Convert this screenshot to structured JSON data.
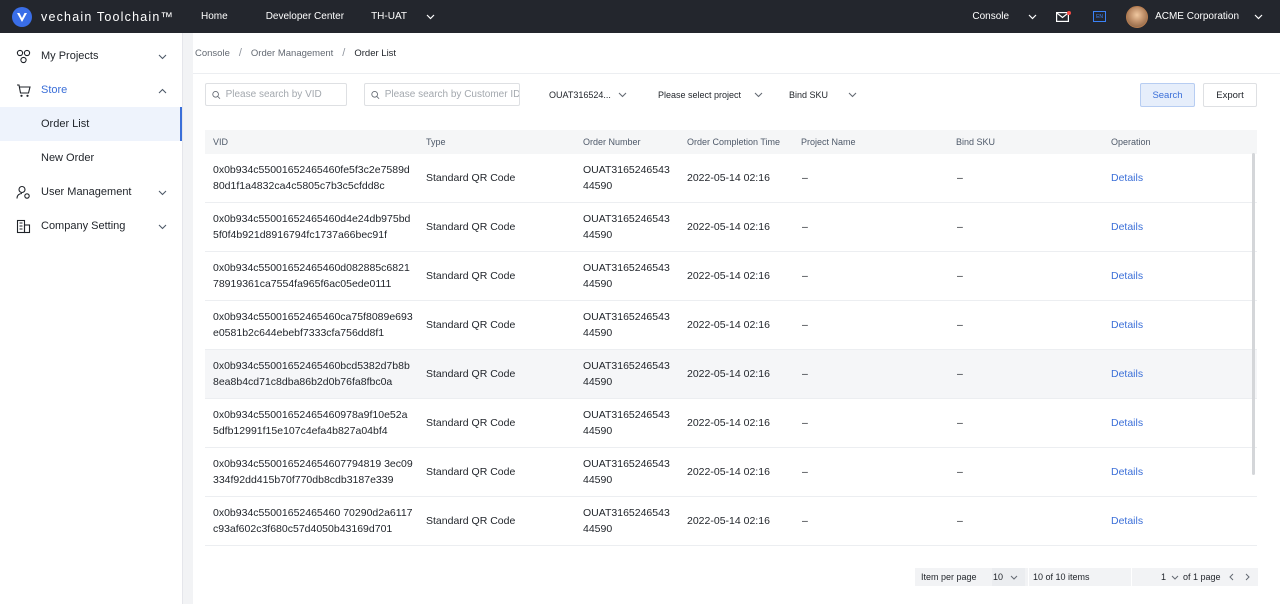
{
  "topbar": {
    "logo_text": "vechain Toolchain™",
    "nav": {
      "home": "Home",
      "developer_center": "Developer Center",
      "environment": "TH-UAT"
    },
    "console": "Console",
    "language_badge": "EN",
    "company": "ACME Corporation",
    "colors": {
      "bg": "#23262d",
      "mail_dot": "#f54a45"
    }
  },
  "sidebar": {
    "my_projects": "My Projects",
    "store": "Store",
    "order_list": "Order List",
    "new_order": "New Order",
    "user_management": "User Management",
    "company_setting": "Company Setting",
    "accent": "#3b6fd8"
  },
  "breadcrumb": {
    "console": "Console",
    "order_management": "Order Management",
    "current": "Order List",
    "sep": "/"
  },
  "filters": {
    "vid_placeholder": "Please search by VID",
    "customer_placeholder": "Please search by Customer ID",
    "order_select": "OUAT316524...",
    "project_select": "Please select project",
    "sku_select": "Bind SKU",
    "search_button": "Search",
    "export_button": "Export"
  },
  "table": {
    "columns": [
      "VID",
      "Type",
      "Order Number",
      "Order Completion Time",
      "Project Name",
      "Bind SKU",
      "Operation"
    ],
    "rows": [
      {
        "vid": "0x0b934c55001652465460fe5f3c2e7589d80d1f1a4832ca4c5805c7b3c5cfdd8c",
        "type": "Standard QR Code",
        "order_number": "OUAT316524654344590",
        "time": "2022-05-14 02:16",
        "project": "–",
        "sku": "–",
        "operation": "Details"
      },
      {
        "vid": "0x0b934c55001652465460d4e24db975bd5f0f4b921d8916794fc1737a66bec91f",
        "type": "Standard QR Code",
        "order_number": "OUAT316524654344590",
        "time": "2022-05-14 02:16",
        "project": "–",
        "sku": "–",
        "operation": "Details"
      },
      {
        "vid": "0x0b934c55001652465460d082885c682178919361ca7554fa965f6ac05ede0111",
        "type": "Standard QR Code",
        "order_number": "OUAT316524654344590",
        "time": "2022-05-14 02:16",
        "project": "–",
        "sku": "–",
        "operation": "Details"
      },
      {
        "vid": "0x0b934c55001652465460ca75f8089e693e0581b2c644ebebf7333cfa756dd8f1",
        "type": "Standard QR Code",
        "order_number": "OUAT316524654344590",
        "time": "2022-05-14 02:16",
        "project": "–",
        "sku": "–",
        "operation": "Details"
      },
      {
        "vid": "0x0b934c55001652465460bcd5382d7b8b8ea8b4cd71c8dba86b2d0b76fa8fbc0a",
        "type": "Standard QR Code",
        "order_number": "OUAT316524654344590",
        "time": "2022-05-14 02:16",
        "project": "–",
        "sku": "–",
        "operation": "Details"
      },
      {
        "vid": "0x0b934c55001652465460978a9f10e52a5dfb12991f15e107c4efa4b827a04bf4",
        "type": "Standard QR Code",
        "order_number": "OUAT316524654344590",
        "time": "2022-05-14 02:16",
        "project": "–",
        "sku": "–",
        "operation": "Details"
      },
      {
        "vid": "0x0b934c550016524654607794819 3ec09334f92dd415b70f770db8cdb3187e339",
        "type": "Standard QR Code",
        "order_number": "OUAT316524654344590",
        "time": "2022-05-14 02:16",
        "project": "–",
        "sku": "–",
        "operation": "Details"
      },
      {
        "vid": "0x0b934c55001652465460 70290d2a6117c93af602c3f680c57d4050b43169d701",
        "type": "Standard QR Code",
        "order_number": "OUAT316524654344590",
        "time": "2022-05-14 02:16",
        "project": "–",
        "sku": "–",
        "operation": "Details"
      }
    ]
  },
  "pagination": {
    "per_page_label": "Item per page",
    "per_page_value": "10",
    "total": "10 of 10 items",
    "current_page": "1",
    "of_pages": "of 1 page"
  }
}
